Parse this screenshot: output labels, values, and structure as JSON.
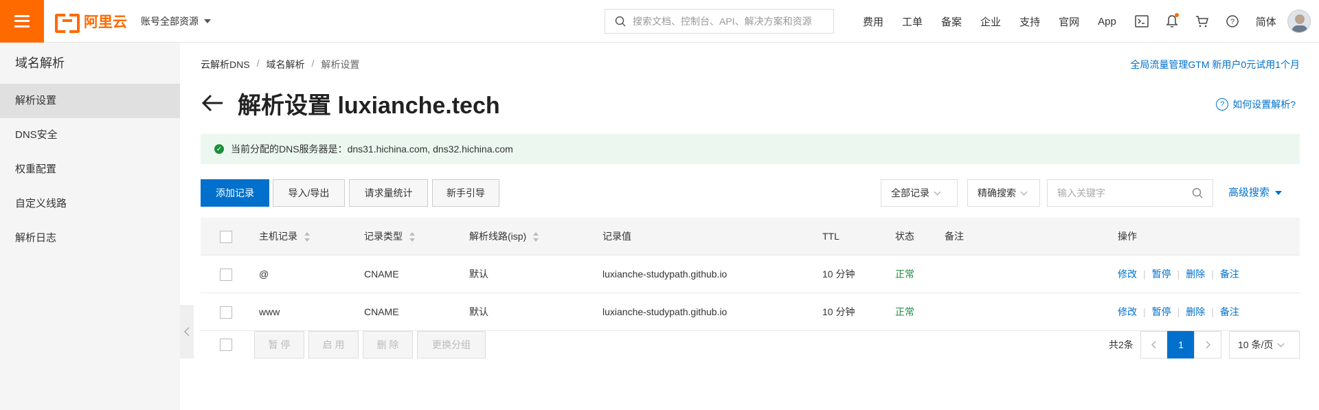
{
  "topbar": {
    "brand": "阿里云",
    "account_scope": "账号全部资源",
    "search_placeholder": "搜索文档、控制台、API、解决方案和资源",
    "links": [
      "费用",
      "工单",
      "备案",
      "企业",
      "支持",
      "官网",
      "App"
    ],
    "language": "简体",
    "accent_color": "#ff6a00"
  },
  "sidebar": {
    "title": "域名解析",
    "items": [
      {
        "label": "解析设置",
        "active": true
      },
      {
        "label": "DNS安全",
        "active": false
      },
      {
        "label": "权重配置",
        "active": false
      },
      {
        "label": "自定义线路",
        "active": false
      },
      {
        "label": "解析日志",
        "active": false
      }
    ]
  },
  "breadcrumb": [
    "云解析DNS",
    "域名解析",
    "解析设置"
  ],
  "promo": "全局流量管理GTM 新用户0元试用1个月",
  "page_title": "解析设置 luxianche.tech",
  "help_link": "如何设置解析?",
  "notice": {
    "label": "当前分配的DNS服务器是：",
    "servers": "dns31.hichina.com, dns32.hichina.com"
  },
  "toolbar": {
    "buttons": [
      "添加记录",
      "导入/导出",
      "请求量统计",
      "新手引导"
    ],
    "record_filter": "全部记录",
    "search_mode": "精确搜索",
    "keyword_placeholder": "输入关键字",
    "advanced_search": "高级搜索"
  },
  "table": {
    "headers": [
      "主机记录",
      "记录类型",
      "解析线路(isp)",
      "记录值",
      "TTL",
      "状态",
      "备注",
      "操作"
    ],
    "rows": [
      {
        "host": "@",
        "type": "CNAME",
        "line": "默认",
        "value": "luxianche-studypath.github.io",
        "ttl": "10 分钟",
        "status": "正常",
        "note": ""
      },
      {
        "host": "www",
        "type": "CNAME",
        "line": "默认",
        "value": "luxianche-studypath.github.io",
        "ttl": "10 分钟",
        "status": "正常",
        "note": ""
      }
    ],
    "row_actions": [
      "修改",
      "暂停",
      "删除",
      "备注"
    ]
  },
  "footer": {
    "bulk_actions": [
      "暂 停",
      "启 用",
      "删 除",
      "更换分组"
    ],
    "total": "共2条",
    "current_page": "1",
    "page_size": "10 条/页"
  }
}
